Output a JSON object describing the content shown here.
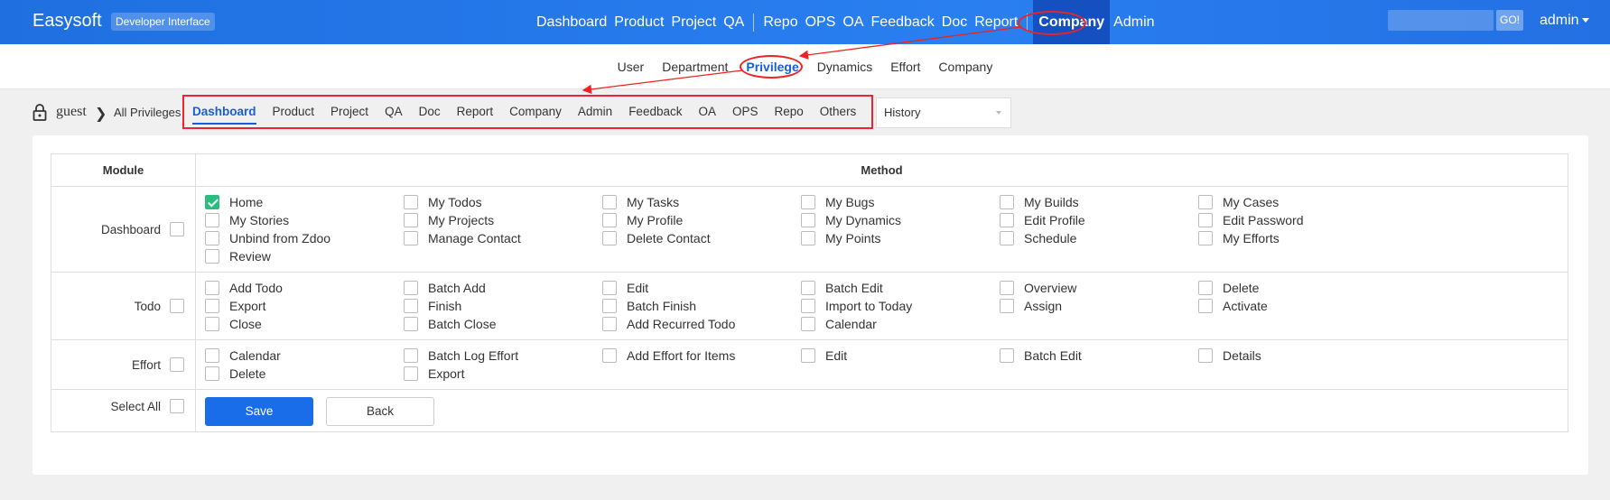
{
  "header": {
    "brand": "Easysoft",
    "brand_sub": "Developer Interface",
    "nav": [
      "Dashboard",
      "Product",
      "Project",
      "QA",
      "Repo",
      "OPS",
      "OA",
      "Feedback",
      "Doc",
      "Report",
      "Company",
      "Admin"
    ],
    "active": "Company",
    "search_placeholder": "",
    "go_label": "GO!",
    "user": "admin"
  },
  "subnav": {
    "items": [
      "User",
      "Department",
      "Privilege",
      "Dynamics",
      "Effort",
      "Company"
    ],
    "active": "Privilege"
  },
  "toolbar": {
    "group": "guest",
    "all_privileges": "All Privileges",
    "tabs": [
      "Dashboard",
      "Product",
      "Project",
      "QA",
      "Doc",
      "Report",
      "Company",
      "Admin",
      "Feedback",
      "OA",
      "OPS",
      "Repo",
      "Others"
    ],
    "active_tab": "Dashboard",
    "version_select": "History"
  },
  "table": {
    "col_module": "Module",
    "col_method": "Method",
    "rows": [
      {
        "module": "Dashboard",
        "methods": [
          "Home",
          "My Todos",
          "My Tasks",
          "My Bugs",
          "My Builds",
          "My Cases",
          "My Stories",
          "My Projects",
          "My Profile",
          "My Dynamics",
          "Edit Profile",
          "Edit Password",
          "Unbind from Zdoo",
          "Manage Contact",
          "Delete Contact",
          "My Points",
          "Schedule",
          "My Efforts",
          "Review"
        ],
        "checked": [
          "Home"
        ]
      },
      {
        "module": "Todo",
        "methods": [
          "Add Todo",
          "Batch Add",
          "Edit",
          "Batch Edit",
          "Overview",
          "Delete",
          "Export",
          "Finish",
          "Batch Finish",
          "Import to Today",
          "Assign",
          "Activate",
          "Close",
          "Batch Close",
          "Add Recurred Todo",
          "Calendar"
        ],
        "checked": []
      },
      {
        "module": "Effort",
        "methods": [
          "Calendar",
          "Batch Log Effort",
          "Add Effort for Items",
          "Edit",
          "Batch Edit",
          "Details",
          "Delete",
          "Export"
        ],
        "checked": []
      }
    ],
    "select_all": "Select All",
    "save": "Save",
    "back": "Back"
  },
  "colors": {
    "header": "#2a7ff0",
    "accent": "#1a6de8",
    "checked": "#2bbd7e",
    "annotation": "#e22222"
  }
}
